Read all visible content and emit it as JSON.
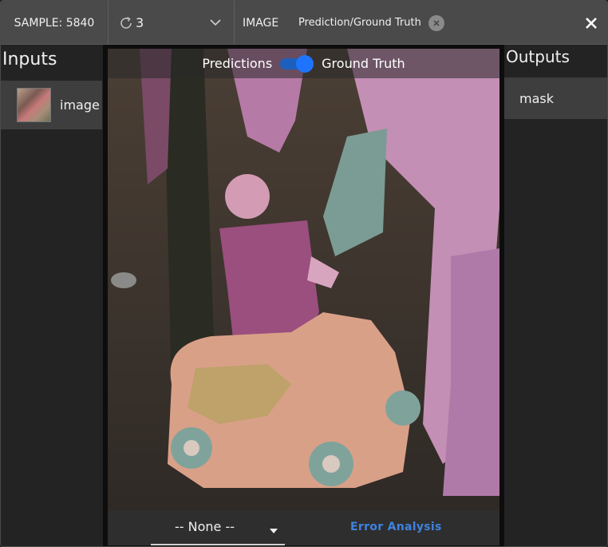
{
  "toolbar": {
    "sample_label": "SAMPLE: 5840",
    "history_value": "3",
    "image_label": "IMAGE",
    "tag_label": "Prediction/Ground Truth"
  },
  "inputs": {
    "title": "Inputs",
    "items": [
      {
        "label": "image"
      }
    ]
  },
  "viewer": {
    "toggle_left": "Predictions",
    "toggle_right": "Ground Truth",
    "toggle_on": true,
    "select_value": "-- None --",
    "error_button": "Error Analysis"
  },
  "outputs": {
    "title": "Outputs",
    "items": [
      {
        "label": "mask"
      }
    ]
  },
  "colors": {
    "accent": "#1f74ff",
    "error_button": "#3f82e0",
    "toolbar_bg": "#4a4a4a",
    "panel_bg": "#232323"
  }
}
